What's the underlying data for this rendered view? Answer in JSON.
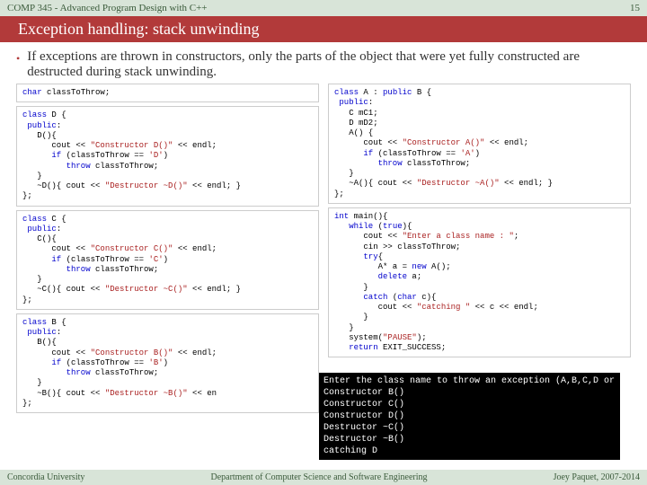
{
  "course": {
    "name": "COMP 345 - Advanced Program Design with C++",
    "page": "15"
  },
  "title": "Exception handling: stack unwinding",
  "body": "If exceptions are thrown in constructors, only the parts of the object that were yet fully constructed are destructed during stack unwinding.",
  "code": {
    "charDecl": {
      "kw1": "char",
      "rest": " classToThrow;"
    },
    "classD": {
      "kw": "class",
      "name": " D {",
      "pub": "public",
      "ctor": "   D(){",
      "coutA": "      cout << ",
      "strCtor": "\"Constructor D()\"",
      "coutB": " << endl;",
      "ifA": "      ",
      "ifKw": "if",
      "ifB": " (classToThrow == ",
      "ifChar": "'D'",
      "ifC": ")",
      "throwA": "         ",
      "throwKw": "throw",
      "throwB": " classToThrow;",
      "close1": "   }",
      "dtor": "   ~D(){ cout << ",
      "strDtor": "\"Destructor ~D()\"",
      "dtorB": " << endl; }",
      "close2": "};"
    },
    "classC": {
      "kw": "class",
      "name": " C {",
      "pub": "public",
      "ctor": "   C(){",
      "coutA": "      cout << ",
      "strCtor": "\"Constructor C()\"",
      "coutB": " << endl;",
      "ifA": "      ",
      "ifKw": "if",
      "ifB": " (classToThrow == ",
      "ifChar": "'C'",
      "ifC": ")",
      "throwA": "         ",
      "throwKw": "throw",
      "throwB": " classToThrow;",
      "close1": "   }",
      "dtor": "   ~C(){ cout << ",
      "strDtor": "\"Destructor ~C()\"",
      "dtorB": " << endl; }",
      "close2": "};"
    },
    "classB": {
      "kw": "class",
      "name": " B {",
      "pub": "public",
      "ctor": "   B(){",
      "coutA": "      cout << ",
      "strCtor": "\"Constructor B()\"",
      "coutB": " << endl;",
      "ifA": "      ",
      "ifKw": "if",
      "ifB": " (classToThrow == ",
      "ifChar": "'B'",
      "ifC": ")",
      "throwA": "         ",
      "throwKw": "throw",
      "throwB": " classToThrow;",
      "close1": "   }",
      "dtor": "   ~B(){ cout << ",
      "strDtor": "\"Destructor ~B()\"",
      "dtorB": " << en",
      "close2": "};"
    },
    "classA": {
      "kw": "class",
      "name": " A : ",
      "pubkw": "public",
      "base": " B {",
      "pub": "public",
      "m1": "   C mC1;",
      "m2": "   D mD2;",
      "ctor": "   A() {",
      "coutA": "      cout << ",
      "strCtor": "\"Constructor A()\"",
      "coutB": " << endl;",
      "ifA": "      ",
      "ifKw": "if",
      "ifB": " (classToThrow == ",
      "ifChar": "'A'",
      "ifC": ")",
      "throwA": "         ",
      "throwKw": "throw",
      "throwB": " classToThrow;",
      "close1": "   }",
      "dtor": "   ~A(){ cout << ",
      "strDtor": "\"Destructor ~A()\"",
      "dtorB": " << endl; }",
      "close2": "};"
    },
    "main": {
      "kwInt": "int",
      "name": " main(){",
      "whileA": "   ",
      "whileKw": "while",
      "whileB": " (",
      "trueKw": "true",
      "whileC": "){",
      "coutA": "      cout << ",
      "strPrompt": "\"Enter a class name : \"",
      "coutB": ";",
      "cin": "      cin >> classToThrow;",
      "tryA": "      ",
      "tryKw": "try",
      "tryB": "{",
      "newA": "         A* a = ",
      "newKw": "new",
      "newB": " A();",
      "delA": "         ",
      "delKw": "delete",
      "delB": " a;",
      "close1": "      }",
      "catchA": "      ",
      "catchKw": "catch",
      "catchB": " (",
      "charKw": "char",
      "catchC": " c){",
      "coutCatchA": "         cout << ",
      "strCatch": "\"catching \"",
      "coutCatchB": " << c << endl;",
      "close2": "      }",
      "close3": "   }",
      "sysA": "   system(",
      "strPause": "\"PAUSE\"",
      "sysB": ");",
      "retA": "   ",
      "retKw": "return",
      "retB": " EXIT_SUCCESS;"
    }
  },
  "console": "Enter the class name to throw an exception (A,B,C,D or X for none): D\nConstructor B()\nConstructor C()\nConstructor D()\nDestructor ~C()\nDestructor ~B()\ncatching D",
  "footer": {
    "left": "Concordia University",
    "center": "Department of Computer Science and Software Engineering",
    "right": "Joey Paquet, 2007-2014"
  }
}
